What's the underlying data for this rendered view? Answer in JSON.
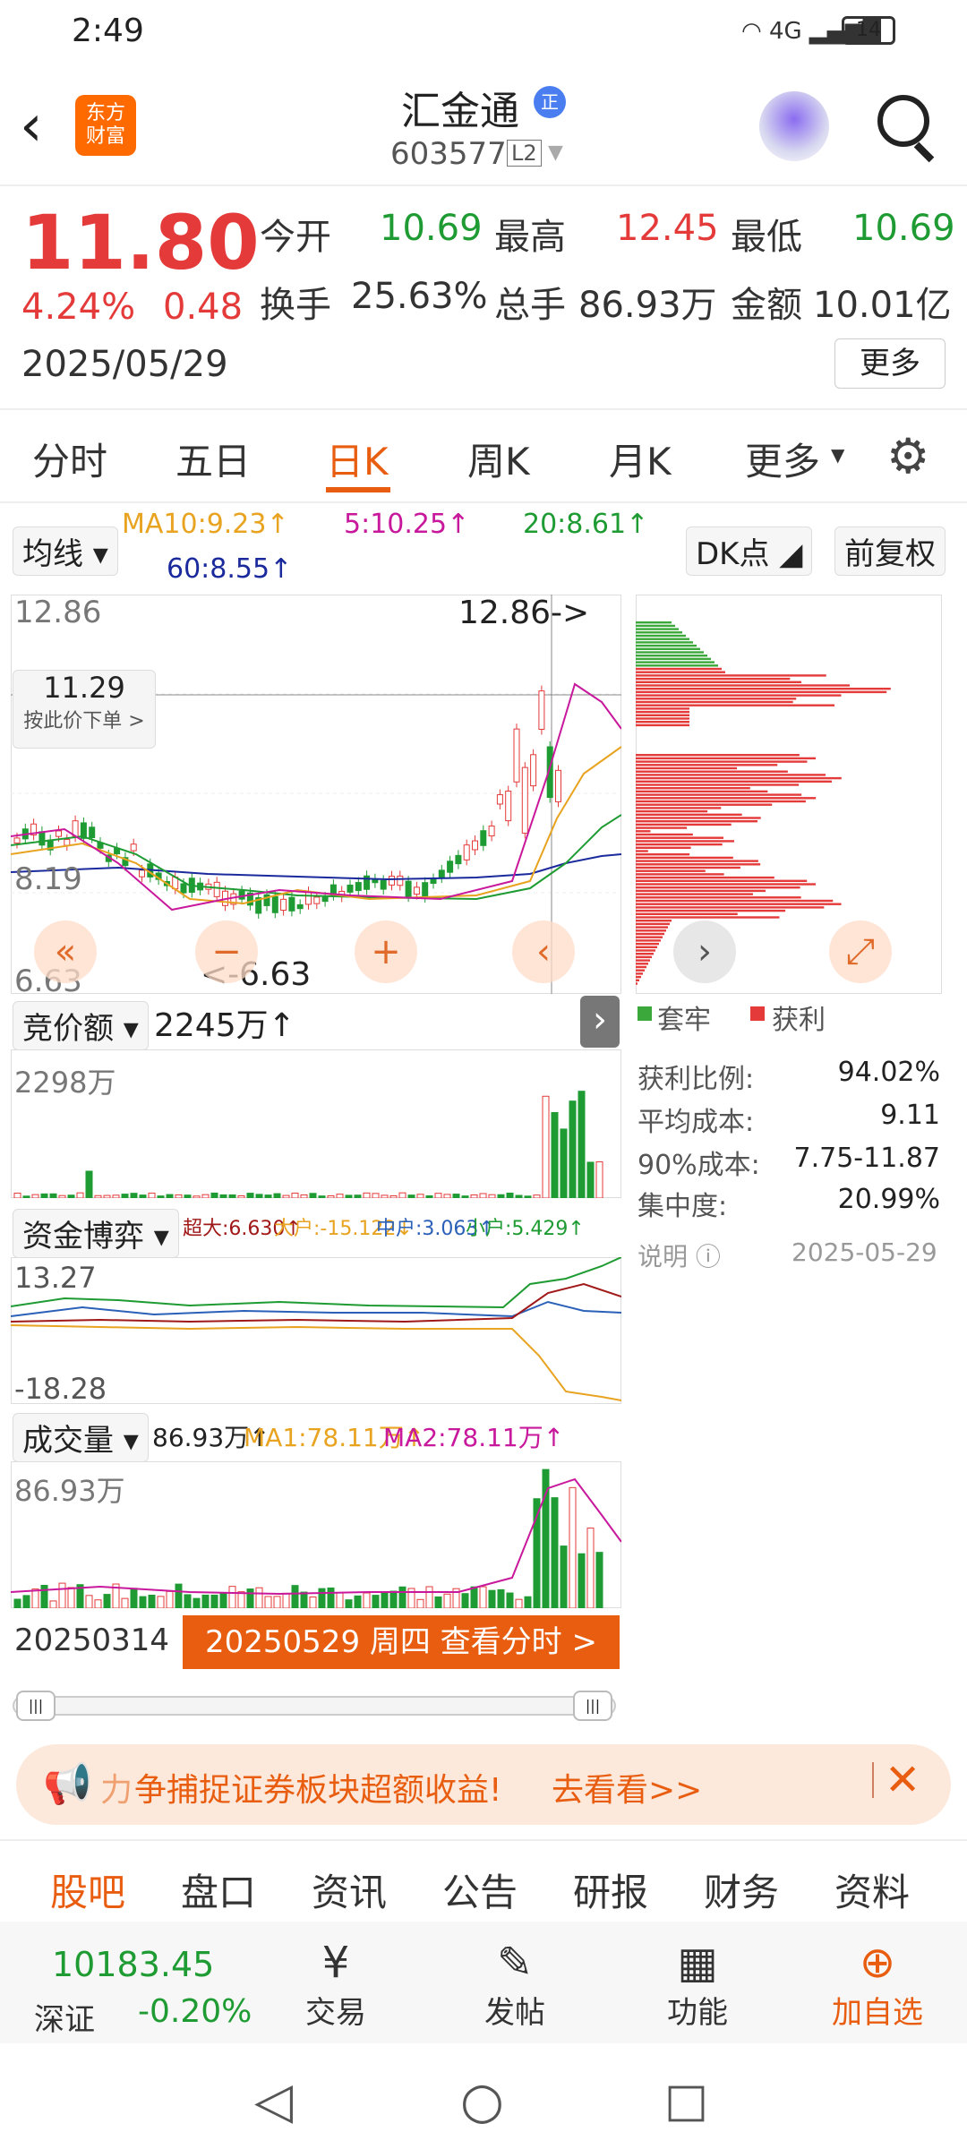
{
  "status": {
    "time": "2:49",
    "battery": "14",
    "net": "4G"
  },
  "header": {
    "name": "汇金通",
    "code": "603577",
    "level": "L2",
    "zheng": "正",
    "brand1": "东方",
    "brand2": "财富"
  },
  "quote": {
    "price": "11.80",
    "pct": "4.24%",
    "chg": "0.48",
    "date": "2025/05/29",
    "open_l": "今开",
    "open": "10.69",
    "high_l": "最高",
    "high": "12.45",
    "low_l": "最低",
    "low": "10.69",
    "turn_l": "换手",
    "turn": "25.63%",
    "vol_l": "总手",
    "vol": "86.93万",
    "amt_l": "金额",
    "amt": "10.01亿",
    "more": "更多"
  },
  "tabs": [
    "分时",
    "五日",
    "日K",
    "周K",
    "月K",
    "更多"
  ],
  "kline": {
    "ma_btn": "均线",
    "ma10": "MA10:9.23↑",
    "ma5": "5:10.25↑",
    "ma20": "20:8.61↑",
    "ma60": "60:8.55↑",
    "dk": "DK点",
    "fq": "前复权",
    "y_top": "12.86",
    "y_mid": "8.19",
    "y_bot": "6.63",
    "y_9": "9.7",
    "cross_price": "11.29",
    "cross_hint": "按此价下单 >",
    "high_mark": "12.86->",
    "low_mark": "<-6.63"
  },
  "chips": {
    "lock": "套牢",
    "profit": "获利",
    "rows": [
      {
        "k": "获利比例:",
        "v": "94.02%"
      },
      {
        "k": "平均成本:",
        "v": "9.11"
      },
      {
        "k": "90%成本:",
        "v": "7.75-11.87"
      },
      {
        "k": "集中度:",
        "v": "20.99%"
      }
    ],
    "note": "说明",
    "date": "2025-05-29"
  },
  "auction": {
    "btn": "竞价额",
    "val": "2245万↑",
    "y_top": "2298万"
  },
  "fund": {
    "btn": "资金博弈",
    "super": "超大:6.630↑",
    "big": "大户:-15.122↓",
    "mid": "中户:3.063↑",
    "small": "小户:5.429↑",
    "y_top": "13.27",
    "y_bot": "-18.28"
  },
  "volume": {
    "btn": "成交量",
    "val": "86.93万↑",
    "ma1": "MA1:78.11万↑",
    "ma2": "MA2:78.11万↑",
    "y_top": "86.93万"
  },
  "timeline": {
    "start": "20250314",
    "tip": "20250529 周四 查看分时 >"
  },
  "banner": {
    "text1": "力",
    "text2": "争捕捉证券板块超额收益!",
    "text3": "去看看>>"
  },
  "bottom_tabs": [
    "股吧",
    "盘口",
    "资讯",
    "公告",
    "研报",
    "财务",
    "资料"
  ],
  "footer": {
    "index_val": "10183.45",
    "index_name": "深证",
    "index_pct": "-0.20%",
    "trade": "交易",
    "post": "发帖",
    "func": "功能",
    "add": "加自选"
  },
  "colors": {
    "red": "#e43a3a",
    "green": "#1e9b32",
    "orange": "#e85d10"
  }
}
